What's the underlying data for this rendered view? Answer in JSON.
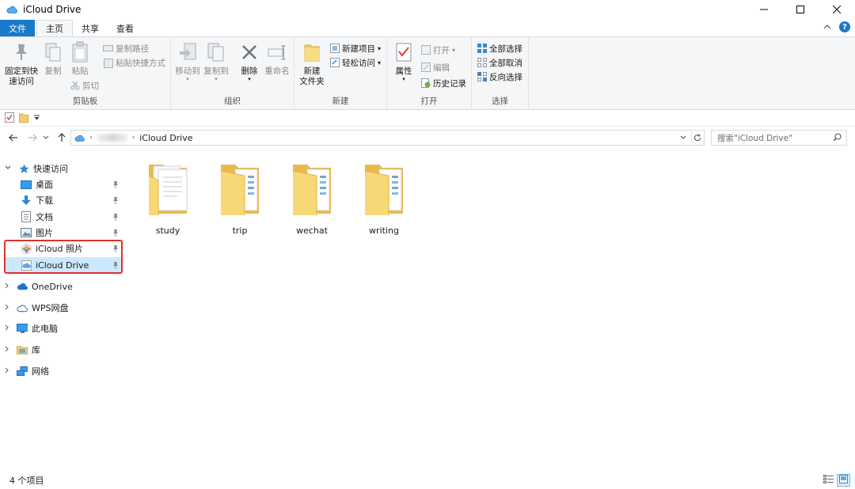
{
  "window": {
    "title": "iCloud Drive"
  },
  "tabs": [
    {
      "label": "文件"
    },
    {
      "label": "主页"
    },
    {
      "label": "共享"
    },
    {
      "label": "查看"
    }
  ],
  "ribbon": {
    "clipboard": {
      "label": "剪贴板",
      "pin_quick_access": "固定到快\n速访问",
      "copy": "复制",
      "paste": "粘贴",
      "copy_path": "复制路径",
      "paste_shortcut": "粘贴快捷方式",
      "cut": "剪切"
    },
    "organize": {
      "label": "组织",
      "move_to": "移动到",
      "copy_to": "复制到",
      "delete": "删除",
      "rename": "重命名"
    },
    "new": {
      "label": "新建",
      "new_folder": "新建\n文件夹",
      "new_item": "新建项目",
      "easy_access": "轻松访问"
    },
    "open": {
      "label": "打开",
      "properties": "属性",
      "open": "打开",
      "edit": "编辑",
      "history": "历史记录"
    },
    "select": {
      "label": "选择",
      "select_all": "全部选择",
      "select_none": "全部取消",
      "invert": "反向选择"
    }
  },
  "address": {
    "current": "iCloud Drive"
  },
  "search": {
    "placeholder": "搜索\"iCloud Drive\""
  },
  "nav": {
    "quick_access": "快速访问",
    "pinned": [
      {
        "label": "桌面"
      },
      {
        "label": "下载"
      },
      {
        "label": "文档"
      },
      {
        "label": "图片"
      },
      {
        "label": "iCloud 照片"
      },
      {
        "label": "iCloud Drive"
      }
    ],
    "roots": [
      {
        "label": "OneDrive"
      },
      {
        "label": "WPS网盘"
      },
      {
        "label": "此电脑"
      },
      {
        "label": "库"
      },
      {
        "label": "网络"
      }
    ]
  },
  "folders": [
    {
      "name": "study"
    },
    {
      "name": "trip"
    },
    {
      "name": "wechat"
    },
    {
      "name": "writing"
    }
  ],
  "status": {
    "count": "4 个项目"
  },
  "colors": {
    "accent": "#1979ca",
    "selection": "#cce8ff",
    "highlight": "#e0312c",
    "folder": "#f3cf6b"
  }
}
